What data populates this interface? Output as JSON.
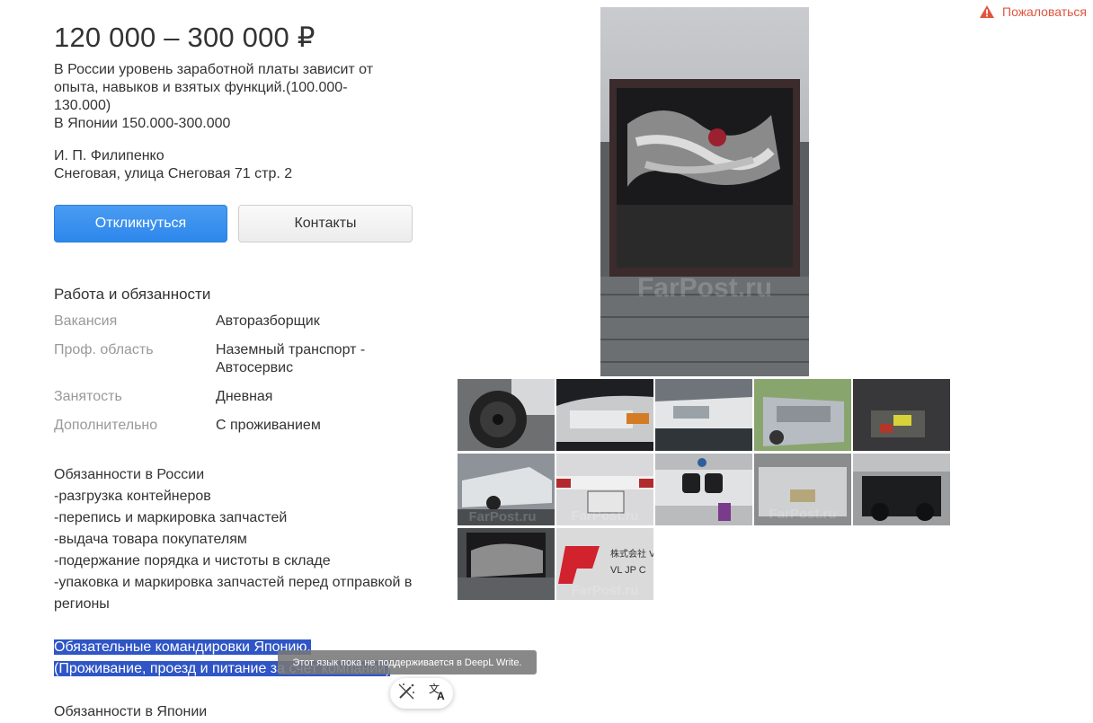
{
  "price": "120 000 – 300 000 ₽",
  "description": [
    "В России уровень заработной платы зависит от",
    "опыта, навыков и взятых функций.(100.000-",
    "130.000)",
    "В Японии 150.000-300.000"
  ],
  "contact": {
    "name": "И. П. Филипенко",
    "address": "Снеговая, улица Снеговая 71 стр. 2"
  },
  "buttons": {
    "respond": "Откликнуться",
    "contacts": "Контакты"
  },
  "complain": "Пожаловаться",
  "section_title": "Работа и обязанности",
  "properties": [
    {
      "key": "Вакансия",
      "value": "Авторазборщик"
    },
    {
      "key": "Проф. область",
      "value": "Наземный транспорт - Автосервис"
    },
    {
      "key": "Занятость",
      "value": "Дневная"
    },
    {
      "key": "Дополнительно",
      "value": "С проживанием"
    }
  ],
  "duties_russia": [
    "Обязанности в России",
    "-разгрузка контейнеров",
    "-перепись и маркировка запчастей",
    "-выдача товара покупателям",
    "-подержание порядка и чистоты в складе",
    "-упаковка и маркировка запчастей перед отправкой в",
    "регионы"
  ],
  "highlighted": [
    "Обязательные командировки Японию.",
    "(Проживание, проезд и питание за счет компании)"
  ],
  "duties_japan_title": "Обязанности в Японии",
  "tooltip": "Этот язык пока не поддерживается в DeepL Write.",
  "watermark": "FarPost.ru",
  "thumb_logo_text": [
    "株式会社 V",
    "VL JP C"
  ],
  "icons": {
    "complain": "warning-triangle-icon",
    "deepl_write": "magic-wand-icon",
    "deepl_translate": "translate-icon"
  },
  "colors": {
    "primary": "#2d87eb",
    "complain": "#e0553f",
    "highlight": "#2f55c6"
  }
}
